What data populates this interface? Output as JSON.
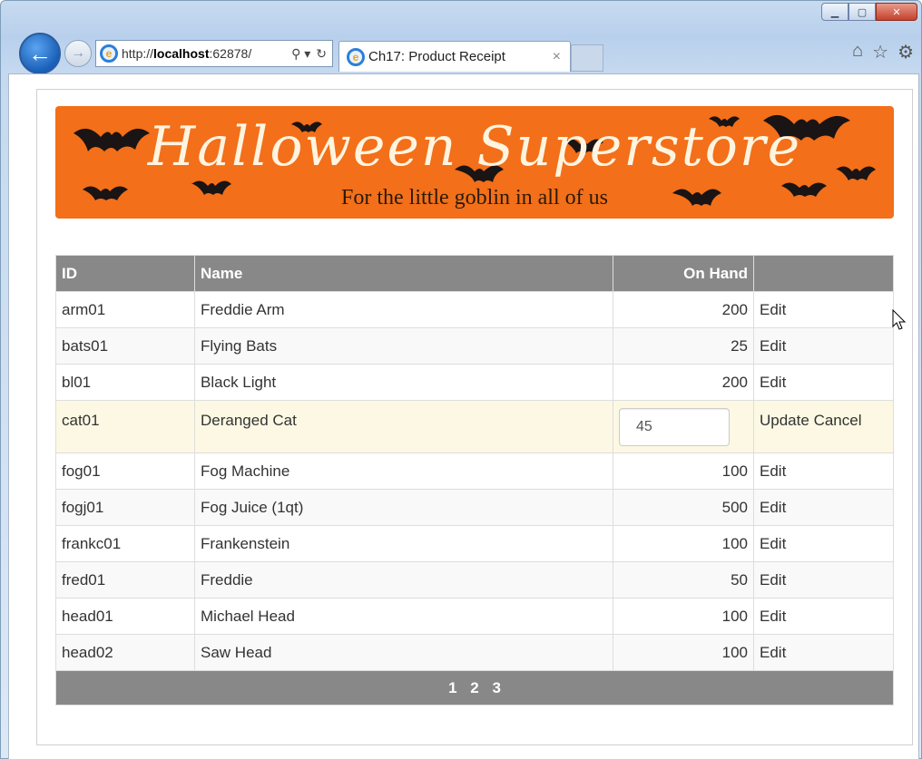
{
  "browser": {
    "address": {
      "prefix": "http://",
      "host": "localhost",
      "rest": ":62878/",
      "search_glyph": "⚲ ▾",
      "refresh_glyph": "↻"
    },
    "tab": {
      "title": "Ch17: Product Receipt",
      "close": "×"
    },
    "window_buttons": {
      "minimize": "▁",
      "maximize": "▢",
      "close": "✕"
    },
    "icons": [
      "home-icon",
      "favorites-star-icon",
      "tools-gear-icon"
    ]
  },
  "banner": {
    "title": "Halloween Superstore",
    "subtitle": "For the little goblin in all of us"
  },
  "grid": {
    "headers": {
      "id": "ID",
      "name": "Name",
      "on_hand": "On Hand",
      "actions": ""
    },
    "rows": [
      {
        "id": "arm01",
        "name": "Freddie Arm",
        "on_hand": "200",
        "action": "Edit"
      },
      {
        "id": "bats01",
        "name": "Flying Bats",
        "on_hand": "25",
        "action": "Edit"
      },
      {
        "id": "bl01",
        "name": "Black Light",
        "on_hand": "200",
        "action": "Edit"
      },
      {
        "id": "cat01",
        "name": "Deranged Cat",
        "on_hand_input": "45",
        "update": "Update",
        "cancel": "Cancel"
      },
      {
        "id": "fog01",
        "name": "Fog Machine",
        "on_hand": "100",
        "action": "Edit"
      },
      {
        "id": "fogj01",
        "name": "Fog Juice (1qt)",
        "on_hand": "500",
        "action": "Edit"
      },
      {
        "id": "frankc01",
        "name": "Frankenstein",
        "on_hand": "100",
        "action": "Edit"
      },
      {
        "id": "fred01",
        "name": "Freddie",
        "on_hand": "50",
        "action": "Edit"
      },
      {
        "id": "head01",
        "name": "Michael Head",
        "on_hand": "100",
        "action": "Edit"
      },
      {
        "id": "head02",
        "name": "Saw Head",
        "on_hand": "100",
        "action": "Edit"
      }
    ],
    "pager": [
      "1",
      "2",
      "3"
    ]
  },
  "colors": {
    "banner": "#f36f19",
    "header": "#888888",
    "editing_row": "#fcf8e3",
    "alt_row": "#f9f9f9"
  }
}
